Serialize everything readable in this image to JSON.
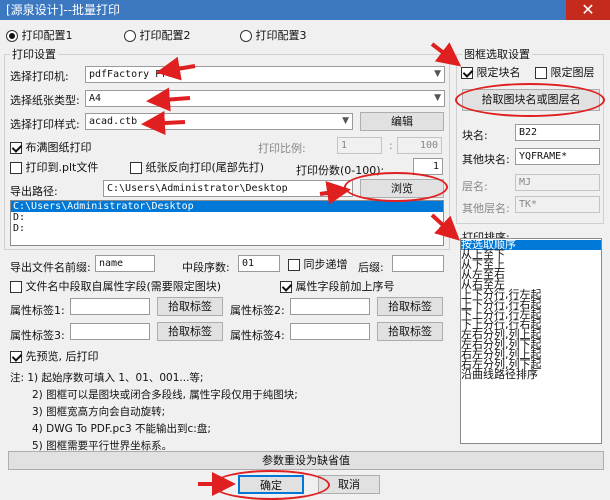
{
  "window": {
    "title": "[源泉设计]--批量打印"
  },
  "config_tabs": [
    "打印配置1",
    "打印配置2",
    "打印配置3"
  ],
  "print_settings": {
    "group_label": "打印设置",
    "printer_label": "选择打印机:",
    "printer_value": "pdfFactory Pro",
    "paper_label": "选择纸张类型:",
    "paper_value": "A4",
    "style_label": "选择打印样式:",
    "style_value": "acad.ctb",
    "edit_button": "编辑",
    "fill_paper_label": "布满图纸打印",
    "scale_label": "打印比例:",
    "scale_a": "1",
    "scale_b": "100",
    "plt_label": "打印到.plt文件",
    "reverse_label": "纸张反向打印(尾部先打)",
    "copies_label": "打印份数(0-100):",
    "copies_value": "1",
    "export_label": "导出路径:",
    "export_value": "C:\\Users\\Administrator\\Desktop",
    "browse_button": "浏览",
    "path_list": [
      "C:\\Users\\Administrator\\Desktop",
      "D:",
      "D:"
    ]
  },
  "filename": {
    "prefix_label": "导出文件名前缀:",
    "prefix_value": "name",
    "mid_digits_label": "中段序数:",
    "mid_digits_value": "01",
    "increment_label": "同步递增",
    "suffix_label": "后缀:",
    "suffix_value": "",
    "mid_from_attr_label": "文件名中段取自属性字段(需要限定图块)",
    "attr_prefix_label": "属性字段前加上序号",
    "attr_tag1_label": "属性标签1:",
    "attr_tag2_label": "属性标签2:",
    "attr_tag3_label": "属性标签3:",
    "attr_tag4_label": "属性标签4:",
    "pick_tag_button": "拾取标签"
  },
  "preview_label": "先预览, 后打印",
  "notes": [
    "注: 1) 起始序数可填入 1、01、001...等;",
    "2) 图框可以是图块或闭合多段线, 属性字段仅用于纯图块;",
    "3) 图框宽高方向会自动旋转;",
    "4) DWG To PDF.pc3 不能输出到c:盘;",
    "5) 图框需要平行世界坐标系。"
  ],
  "frame_select": {
    "group_label": "图框选取设置",
    "limit_block_label": "限定块名",
    "limit_layer_label": "限定图层",
    "pick_button": "拾取图块名或图层名",
    "block_name_label": "块名:",
    "block_name_value": "B22",
    "other_block_label": "其他块名:",
    "other_block_value": "YQFRAME*",
    "layer_label": "层名:",
    "layer_value": "MJ",
    "other_layer_label": "其他层名:",
    "other_layer_value": "TK*"
  },
  "sort": {
    "label": "打印排序:",
    "items": [
      "按选取顺序",
      "从上至下",
      "从下至上",
      "从左至右",
      "从右至左",
      "上下分行,行左起",
      "上下分行,行右起",
      "下上分行,行左起",
      "下上分行,行右起",
      "左右分列,列上起",
      "左右分列,列下起",
      "右左分列,列上起",
      "右左分列,列下起",
      "沿曲线路径排序"
    ],
    "selected_index": 0
  },
  "reset_button": "参数重设为缺省值",
  "ok_button": "确定",
  "cancel_button": "取消",
  "annotation_color": "#e02020"
}
